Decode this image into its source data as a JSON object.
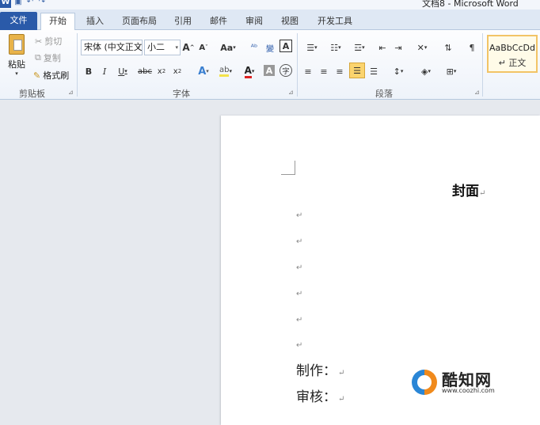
{
  "window": {
    "title": "文档8 - Microsoft Word",
    "app_icon_letter": "W"
  },
  "tabs": [
    {
      "label": "文件"
    },
    {
      "label": "开始"
    },
    {
      "label": "插入"
    },
    {
      "label": "页面布局"
    },
    {
      "label": "引用"
    },
    {
      "label": "邮件"
    },
    {
      "label": "审阅"
    },
    {
      "label": "视图"
    },
    {
      "label": "开发工具"
    }
  ],
  "clipboard": {
    "paste": "粘贴",
    "cut": "剪切",
    "copy": "复制",
    "format_painter": "格式刷",
    "group": "剪贴板"
  },
  "font": {
    "name": "宋体 (中文正文",
    "size": "小二",
    "aa_label": "Aa",
    "group": "字体"
  },
  "paragraph": {
    "group": "段落"
  },
  "styles": {
    "preview": "AaBbCcDd",
    "normal": "↵ 正文"
  },
  "document": {
    "title": "封面",
    "line_maker": "制作：",
    "line_reviewer": "审核：",
    "para_mark": "↵"
  },
  "watermark": {
    "name": "酷知网",
    "url": "www.coozhi.com"
  },
  "colors": {
    "file_tab": "#2a5aa9",
    "ribbon_border": "#b6c8de",
    "style_highlight": "#f2c466"
  }
}
